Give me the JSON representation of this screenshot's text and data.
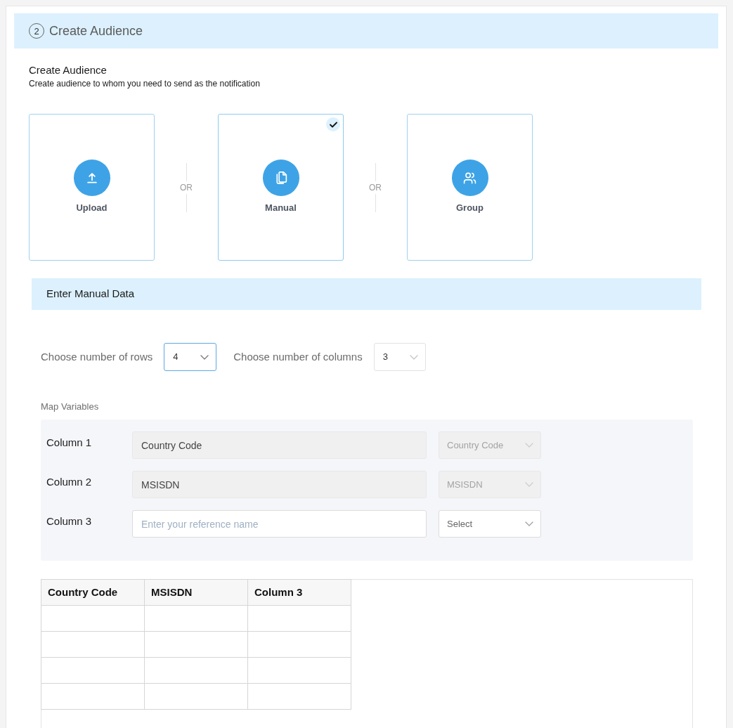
{
  "section": {
    "step": "2",
    "title": "Create Audience"
  },
  "intro": {
    "title": "Create Audience",
    "description": "Create audience to whom you need to send as the notification"
  },
  "options": [
    {
      "kind": "upload",
      "label": "Upload",
      "selected": false
    },
    {
      "kind": "manual",
      "label": "Manual",
      "selected": true
    },
    {
      "kind": "group",
      "label": "Group",
      "selected": false
    }
  ],
  "separators": [
    "OR",
    "OR"
  ],
  "manual_data": {
    "title": "Enter Manual Data",
    "rows_select": {
      "label": "Choose number of rows",
      "value": "4",
      "focused": true
    },
    "columns_select": {
      "label": "Choose number of columns",
      "value": "3",
      "focused": false
    }
  },
  "map_variables": {
    "title": "Map Variables",
    "rows": [
      {
        "label": "Column 1",
        "name_field": {
          "value": "Country Code",
          "disabled": true
        },
        "type_select": {
          "value": "Country Code",
          "disabled": true
        }
      },
      {
        "label": "Column 2",
        "name_field": {
          "value": "MSISDN",
          "disabled": true
        },
        "type_select": {
          "value": "MSISDN",
          "disabled": true
        }
      },
      {
        "label": "Column 3",
        "name_field": {
          "placeholder": "Enter your reference name",
          "disabled": false
        },
        "type_select": {
          "placeholder": "Select",
          "disabled": false
        }
      }
    ]
  },
  "table": {
    "columns": [
      "Country Code",
      "MSISDN",
      "Column 3"
    ],
    "rows": [
      {
        "selected": false
      },
      {
        "selected": false
      },
      {
        "selected": false
      },
      {
        "selected": false
      }
    ]
  }
}
